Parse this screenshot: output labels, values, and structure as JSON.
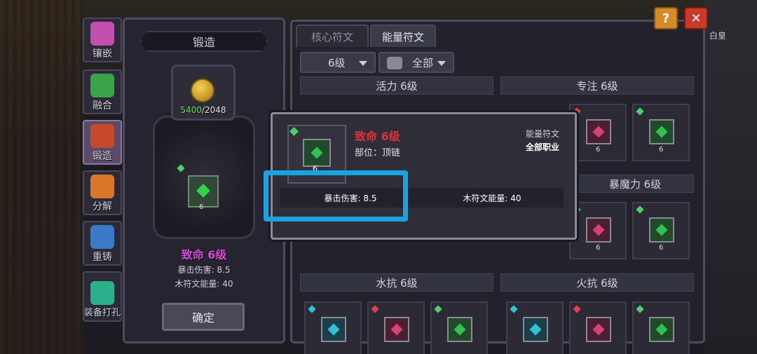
{
  "side_nav": [
    {
      "label": "镶嵌",
      "color": "#c24fb0"
    },
    {
      "label": "融合",
      "color": "#3aa24a"
    },
    {
      "label": "锻造",
      "color": "#c44a2a"
    },
    {
      "label": "分解",
      "color": "#d8762a"
    },
    {
      "label": "重铸",
      "color": "#3a7ac8"
    },
    {
      "label": "装备打孔",
      "color": "#2ab08a"
    }
  ],
  "forge": {
    "title": "锻造",
    "cost_current": "5400",
    "cost_required": "/2048",
    "rune_level": "6",
    "rune_name": "致命 6级",
    "stat_1": "暴击伤害: 8.5",
    "stat_2": "木符文能量: 40",
    "confirm_label": "确定"
  },
  "tabs": {
    "core": "核心符文",
    "energy": "能量符文"
  },
  "filters": {
    "level": "6级",
    "class": "全部"
  },
  "categories": {
    "vitality": "活力 6级",
    "focus": "专注 6级",
    "magic": "暴魔力 6级",
    "water_res": "水抗 6级",
    "fire_res": "火抗 6级"
  },
  "rune_level_label": "6",
  "buttons": {
    "help": "?",
    "close": "✕",
    "white_label": "白皇"
  },
  "tooltip": {
    "name": "致命 6级",
    "slot": "部位：顶链",
    "type": "能量符文",
    "class": "全部职业",
    "icon_level": "6",
    "stat_left": "暴击伤害: 8.5",
    "stat_right": "木符文能量: 40"
  },
  "colors": {
    "highlight": "#1aa3e0",
    "tooltip_name": "#e0323a",
    "forge_name": "#d84ad8"
  }
}
